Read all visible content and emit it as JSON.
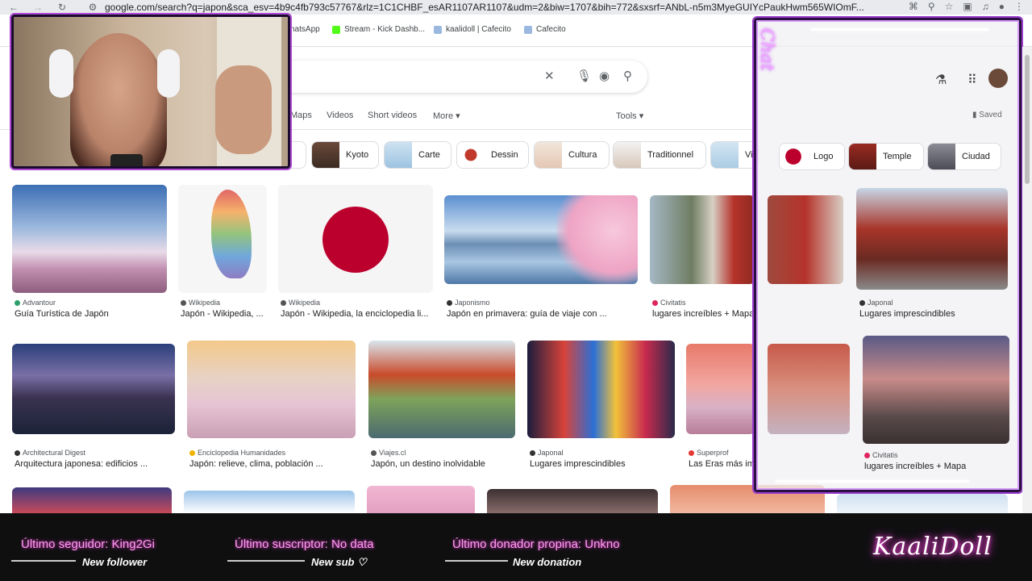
{
  "browser": {
    "url": "google.com/search?q=japon&sca_esv=4b9c4fb793c57767&rlz=1C1CHBF_esAR1107AR1107&udm=2&biw=1707&bih=772&sxsrf=ANbL-n5m3MyeGUIYcPaukHwm565WIOmF...",
    "bookmarks": [
      "natsApp",
      "Stream - Kick Dashb...",
      "kaalidoll | Cafecito",
      "Cafecito"
    ]
  },
  "search": {
    "tabs": [
      "Maps",
      "Videos",
      "Short videos",
      "More"
    ],
    "tools_label": "Tools",
    "chips": [
      {
        "label": "ra"
      },
      {
        "label": "Kyoto"
      },
      {
        "label": "Carte"
      },
      {
        "label": "Dessin"
      },
      {
        "label": "Cultura"
      },
      {
        "label": "Traditionnel"
      },
      {
        "label": "Vi"
      },
      {
        "label": "Logo"
      },
      {
        "label": "Temple"
      },
      {
        "label": "Ciudad"
      }
    ],
    "saved_label": "Saved"
  },
  "results": [
    {
      "source": "Advantour",
      "caption": "Guía Turística de Japón"
    },
    {
      "source": "Wikipedia",
      "caption": "Japón - Wikipedia, ..."
    },
    {
      "source": "Wikipedia",
      "caption": "Japón - Wikipedia, la enciclopedia li..."
    },
    {
      "source": "Japonismo",
      "caption": "Japón en primavera: guía de viaje con ..."
    },
    {
      "source": "Civitatis",
      "caption": "lugares increíbles + Mapa"
    },
    {
      "source": "Japonal",
      "caption": "Lugares imprescindibles"
    },
    {
      "source": "Architectural Digest",
      "caption": "Arquitectura japonesa: edificios ..."
    },
    {
      "source": "Enciclopedia Humanidades",
      "caption": "Japón: relieve, clima, población ..."
    },
    {
      "source": "Viajes.cl",
      "caption": "Japón, un destino inolvidable"
    },
    {
      "source": "Japonal",
      "caption": "Lugares imprescindibles"
    },
    {
      "source": "Superprof",
      "caption": "Las Eras más importantes de Japón"
    },
    {
      "source": "Civitatis",
      "caption": "lugares increíbles + Mapa"
    }
  ],
  "chat": {
    "title": "Chat"
  },
  "stream": {
    "follower": "Último seguidor: King2Gi",
    "follower_sub": "New follower",
    "subscriber": "Último suscriptor: No data",
    "subscriber_sub": "New sub ♡",
    "donation": "Último donador propina: Unkno",
    "donation_sub": "New donation",
    "logo": "KaaliDoll"
  },
  "colors": {
    "stream_pink": "#ff9cf2",
    "overlay_purple": "#9b3dd0"
  }
}
